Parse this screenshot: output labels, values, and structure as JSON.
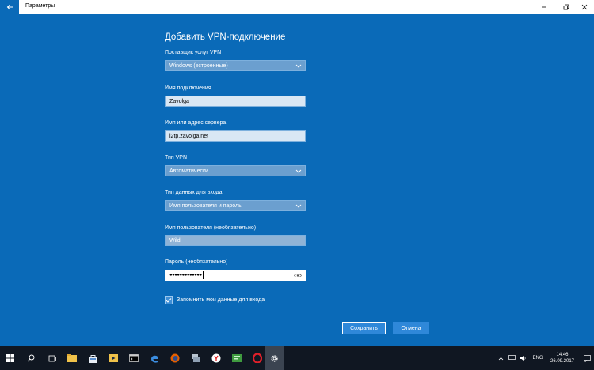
{
  "window": {
    "title": "Параметры"
  },
  "dialog": {
    "title": "Добавить VPN-подключение",
    "provider": {
      "label": "Поставщик услуг VPN",
      "value": "Windows (встроенные)"
    },
    "connection_name": {
      "label": "Имя подключения",
      "value": "Zavolga"
    },
    "server": {
      "label": "Имя или адрес сервера",
      "value": "l2tp.zavolga.net"
    },
    "vpn_type": {
      "label": "Тип VPN",
      "value": "Автоматически"
    },
    "sign_in_type": {
      "label": "Тип данных для входа",
      "value": "Имя пользователя и пароль"
    },
    "username": {
      "label": "Имя пользователя (необязательно)",
      "value": "Wild"
    },
    "password": {
      "label": "Пароль (необязательно)",
      "value": "●●●●●●●●●●●●●"
    },
    "remember": {
      "label": "Запомнить мои данные для входа",
      "checked": true
    },
    "save_label": "Сохранить",
    "cancel_label": "Отмена"
  },
  "taskbar": {
    "language": "ENG",
    "time": "14:46",
    "date": "26.09.2017",
    "apps": [
      "start-icon",
      "search-icon",
      "task-view-icon",
      "file-explorer-icon",
      "store-icon",
      "media-player-icon",
      "command-prompt-icon",
      "edge-icon",
      "firefox-icon",
      "network-app-icon",
      "yandex-browser-icon",
      "terminal-icon",
      "opera-icon",
      "settings-icon"
    ]
  },
  "colors": {
    "background": "#0a6ab8",
    "taskbar": "#101722",
    "accent_button": "#2f88d9"
  }
}
